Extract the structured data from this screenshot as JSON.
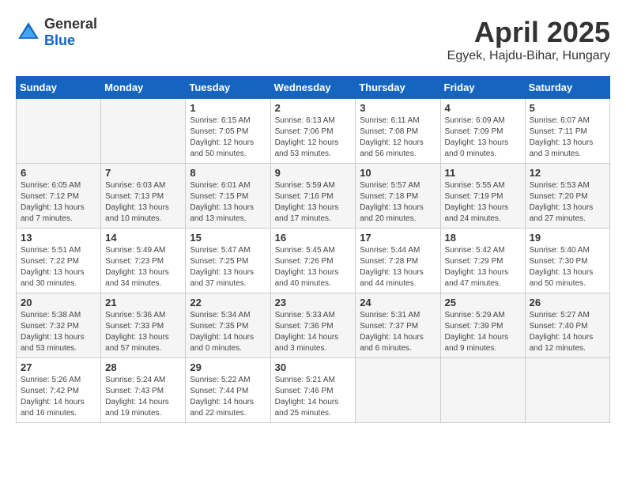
{
  "header": {
    "logo_general": "General",
    "logo_blue": "Blue",
    "month": "April 2025",
    "location": "Egyek, Hajdu-Bihar, Hungary"
  },
  "days_of_week": [
    "Sunday",
    "Monday",
    "Tuesday",
    "Wednesday",
    "Thursday",
    "Friday",
    "Saturday"
  ],
  "weeks": [
    [
      {
        "day": "",
        "info": ""
      },
      {
        "day": "",
        "info": ""
      },
      {
        "day": "1",
        "info": "Sunrise: 6:15 AM\nSunset: 7:05 PM\nDaylight: 12 hours\nand 50 minutes."
      },
      {
        "day": "2",
        "info": "Sunrise: 6:13 AM\nSunset: 7:06 PM\nDaylight: 12 hours\nand 53 minutes."
      },
      {
        "day": "3",
        "info": "Sunrise: 6:11 AM\nSunset: 7:08 PM\nDaylight: 12 hours\nand 56 minutes."
      },
      {
        "day": "4",
        "info": "Sunrise: 6:09 AM\nSunset: 7:09 PM\nDaylight: 13 hours\nand 0 minutes."
      },
      {
        "day": "5",
        "info": "Sunrise: 6:07 AM\nSunset: 7:11 PM\nDaylight: 13 hours\nand 3 minutes."
      }
    ],
    [
      {
        "day": "6",
        "info": "Sunrise: 6:05 AM\nSunset: 7:12 PM\nDaylight: 13 hours\nand 7 minutes."
      },
      {
        "day": "7",
        "info": "Sunrise: 6:03 AM\nSunset: 7:13 PM\nDaylight: 13 hours\nand 10 minutes."
      },
      {
        "day": "8",
        "info": "Sunrise: 6:01 AM\nSunset: 7:15 PM\nDaylight: 13 hours\nand 13 minutes."
      },
      {
        "day": "9",
        "info": "Sunrise: 5:59 AM\nSunset: 7:16 PM\nDaylight: 13 hours\nand 17 minutes."
      },
      {
        "day": "10",
        "info": "Sunrise: 5:57 AM\nSunset: 7:18 PM\nDaylight: 13 hours\nand 20 minutes."
      },
      {
        "day": "11",
        "info": "Sunrise: 5:55 AM\nSunset: 7:19 PM\nDaylight: 13 hours\nand 24 minutes."
      },
      {
        "day": "12",
        "info": "Sunrise: 5:53 AM\nSunset: 7:20 PM\nDaylight: 13 hours\nand 27 minutes."
      }
    ],
    [
      {
        "day": "13",
        "info": "Sunrise: 5:51 AM\nSunset: 7:22 PM\nDaylight: 13 hours\nand 30 minutes."
      },
      {
        "day": "14",
        "info": "Sunrise: 5:49 AM\nSunset: 7:23 PM\nDaylight: 13 hours\nand 34 minutes."
      },
      {
        "day": "15",
        "info": "Sunrise: 5:47 AM\nSunset: 7:25 PM\nDaylight: 13 hours\nand 37 minutes."
      },
      {
        "day": "16",
        "info": "Sunrise: 5:45 AM\nSunset: 7:26 PM\nDaylight: 13 hours\nand 40 minutes."
      },
      {
        "day": "17",
        "info": "Sunrise: 5:44 AM\nSunset: 7:28 PM\nDaylight: 13 hours\nand 44 minutes."
      },
      {
        "day": "18",
        "info": "Sunrise: 5:42 AM\nSunset: 7:29 PM\nDaylight: 13 hours\nand 47 minutes."
      },
      {
        "day": "19",
        "info": "Sunrise: 5:40 AM\nSunset: 7:30 PM\nDaylight: 13 hours\nand 50 minutes."
      }
    ],
    [
      {
        "day": "20",
        "info": "Sunrise: 5:38 AM\nSunset: 7:32 PM\nDaylight: 13 hours\nand 53 minutes."
      },
      {
        "day": "21",
        "info": "Sunrise: 5:36 AM\nSunset: 7:33 PM\nDaylight: 13 hours\nand 57 minutes."
      },
      {
        "day": "22",
        "info": "Sunrise: 5:34 AM\nSunset: 7:35 PM\nDaylight: 14 hours\nand 0 minutes."
      },
      {
        "day": "23",
        "info": "Sunrise: 5:33 AM\nSunset: 7:36 PM\nDaylight: 14 hours\nand 3 minutes."
      },
      {
        "day": "24",
        "info": "Sunrise: 5:31 AM\nSunset: 7:37 PM\nDaylight: 14 hours\nand 6 minutes."
      },
      {
        "day": "25",
        "info": "Sunrise: 5:29 AM\nSunset: 7:39 PM\nDaylight: 14 hours\nand 9 minutes."
      },
      {
        "day": "26",
        "info": "Sunrise: 5:27 AM\nSunset: 7:40 PM\nDaylight: 14 hours\nand 12 minutes."
      }
    ],
    [
      {
        "day": "27",
        "info": "Sunrise: 5:26 AM\nSunset: 7:42 PM\nDaylight: 14 hours\nand 16 minutes."
      },
      {
        "day": "28",
        "info": "Sunrise: 5:24 AM\nSunset: 7:43 PM\nDaylight: 14 hours\nand 19 minutes."
      },
      {
        "day": "29",
        "info": "Sunrise: 5:22 AM\nSunset: 7:44 PM\nDaylight: 14 hours\nand 22 minutes."
      },
      {
        "day": "30",
        "info": "Sunrise: 5:21 AM\nSunset: 7:46 PM\nDaylight: 14 hours\nand 25 minutes."
      },
      {
        "day": "",
        "info": ""
      },
      {
        "day": "",
        "info": ""
      },
      {
        "day": "",
        "info": ""
      }
    ]
  ]
}
